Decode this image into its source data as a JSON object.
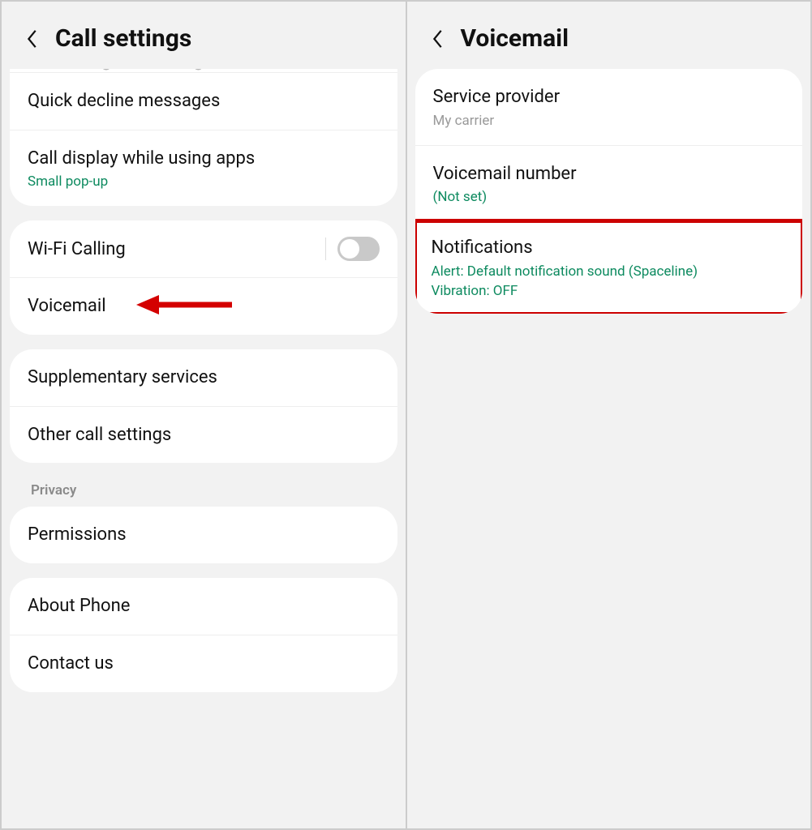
{
  "left": {
    "title": "Call settings",
    "truncated": "Answering and ending calls",
    "group1": {
      "quickDecline": "Quick decline messages",
      "callDisplay": "Call display while using apps",
      "callDisplaySub": "Small pop-up"
    },
    "group2": {
      "wifiCalling": "Wi-Fi Calling",
      "voicemail": "Voicemail"
    },
    "group3": {
      "supp": "Supplementary services",
      "other": "Other call settings"
    },
    "privacyHeader": "Privacy",
    "group4": {
      "permissions": "Permissions"
    },
    "group5": {
      "about": "About Phone",
      "contact": "Contact us"
    }
  },
  "right": {
    "title": "Voicemail",
    "provider": {
      "label": "Service provider",
      "value": "My carrier"
    },
    "number": {
      "label": "Voicemail number",
      "value": "(Not set)"
    },
    "notifications": {
      "label": "Notifications",
      "line1": "Alert: Default notification sound (Spaceline)",
      "line2": "Vibration: OFF"
    }
  }
}
